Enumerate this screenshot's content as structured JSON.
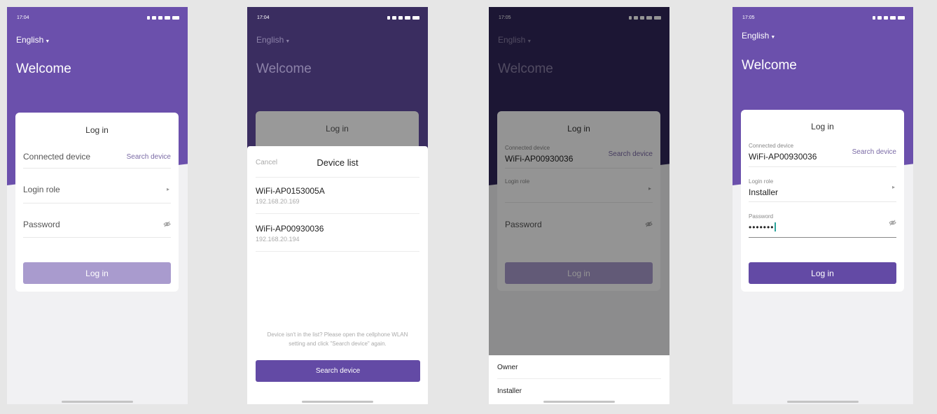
{
  "colors": {
    "primary": "#634aa5",
    "header": "#6b50ac",
    "disabled": "#a99bce",
    "link": "#7a6aa5"
  },
  "screen1": {
    "time": "17:04",
    "language": "English",
    "welcome": "Welcome",
    "login_title": "Log in",
    "connected_device_label": "Connected device",
    "search_device_link": "Search device",
    "login_role_label": "Login role",
    "password_label": "Password",
    "login_button": "Log in"
  },
  "screen2": {
    "time": "17:04",
    "language": "English",
    "welcome": "Welcome",
    "login_title": "Log in",
    "cancel": "Cancel",
    "device_list_title": "Device list",
    "devices": [
      {
        "name": "WiFi-AP0153005A",
        "ip": "192.168.20.169"
      },
      {
        "name": "WiFi-AP00930036",
        "ip": "192.168.20.194"
      }
    ],
    "hint": "Device isn't in the list? Please open the cellphone WLAN setting and click \"Search device\" again.",
    "search_button": "Search device"
  },
  "screen3": {
    "time": "17:05",
    "language": "English",
    "welcome": "Welcome",
    "login_title": "Log in",
    "connected_device_label": "Connected device",
    "connected_device_value": "WiFi-AP00930036",
    "search_device_link": "Search device",
    "login_role_label": "Login role",
    "password_label": "Password",
    "login_button": "Log in",
    "role_options": [
      "Owner",
      "Installer"
    ]
  },
  "screen4": {
    "time": "17:05",
    "language": "English",
    "welcome": "Welcome",
    "login_title": "Log in",
    "connected_device_label": "Connected device",
    "connected_device_value": "WiFi-AP00930036",
    "search_device_link": "Search device",
    "login_role_label": "Login role",
    "login_role_value": "Installer",
    "password_label": "Password",
    "password_value": "•••••••",
    "login_button": "Log in"
  }
}
